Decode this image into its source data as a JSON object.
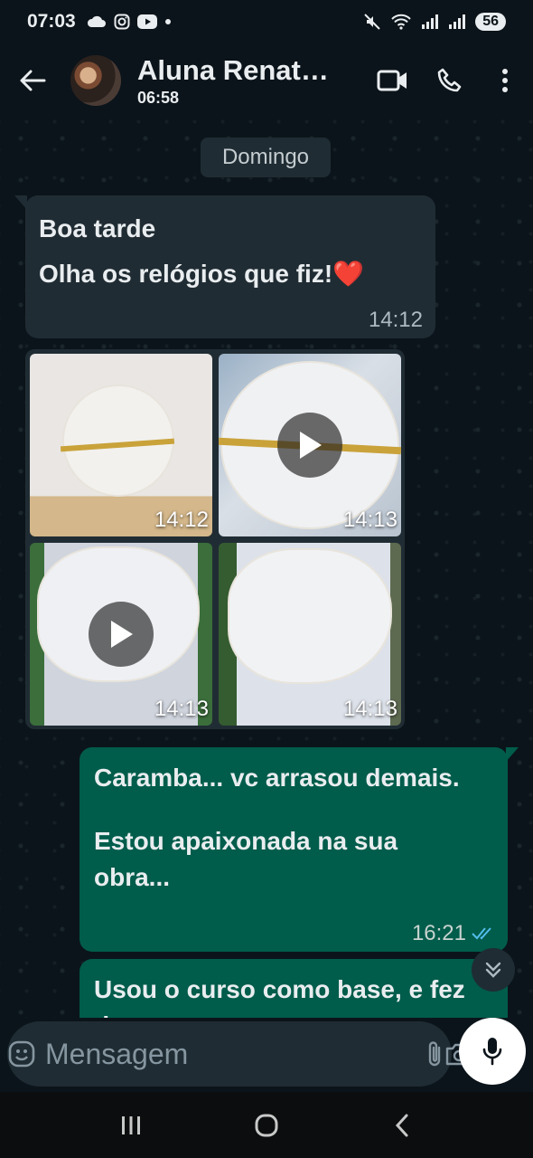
{
  "status_bar": {
    "time": "07:03",
    "battery": "56"
  },
  "header": {
    "contact_name": "Aluna Renat…",
    "last_seen": "06:58"
  },
  "chat": {
    "date_chip": "Domingo",
    "incoming_message": {
      "line1": "Boa tarde",
      "line2": "Olha os relógios que fiz!",
      "emoji": "❤️",
      "time": "14:12"
    },
    "media_album": [
      {
        "time": "14:12",
        "type": "photo"
      },
      {
        "time": "14:13",
        "type": "video"
      },
      {
        "time": "14:13",
        "type": "video"
      },
      {
        "time": "14:13",
        "type": "photo"
      }
    ],
    "outgoing_message_1": {
      "line1": "Caramba... vc arrasou demais.",
      "line2": "Estou apaixonada na sua obra...",
      "time": "16:21",
      "status": "read"
    },
    "outgoing_message_2": {
      "text": "Usou o curso como base, e fez do..."
    }
  },
  "composer": {
    "placeholder": "Mensagem"
  },
  "colors": {
    "background": "#0b141a",
    "incoming_bubble": "#202c33",
    "outgoing_bubble": "#005c4b",
    "read_ticks": "#53bdeb"
  }
}
